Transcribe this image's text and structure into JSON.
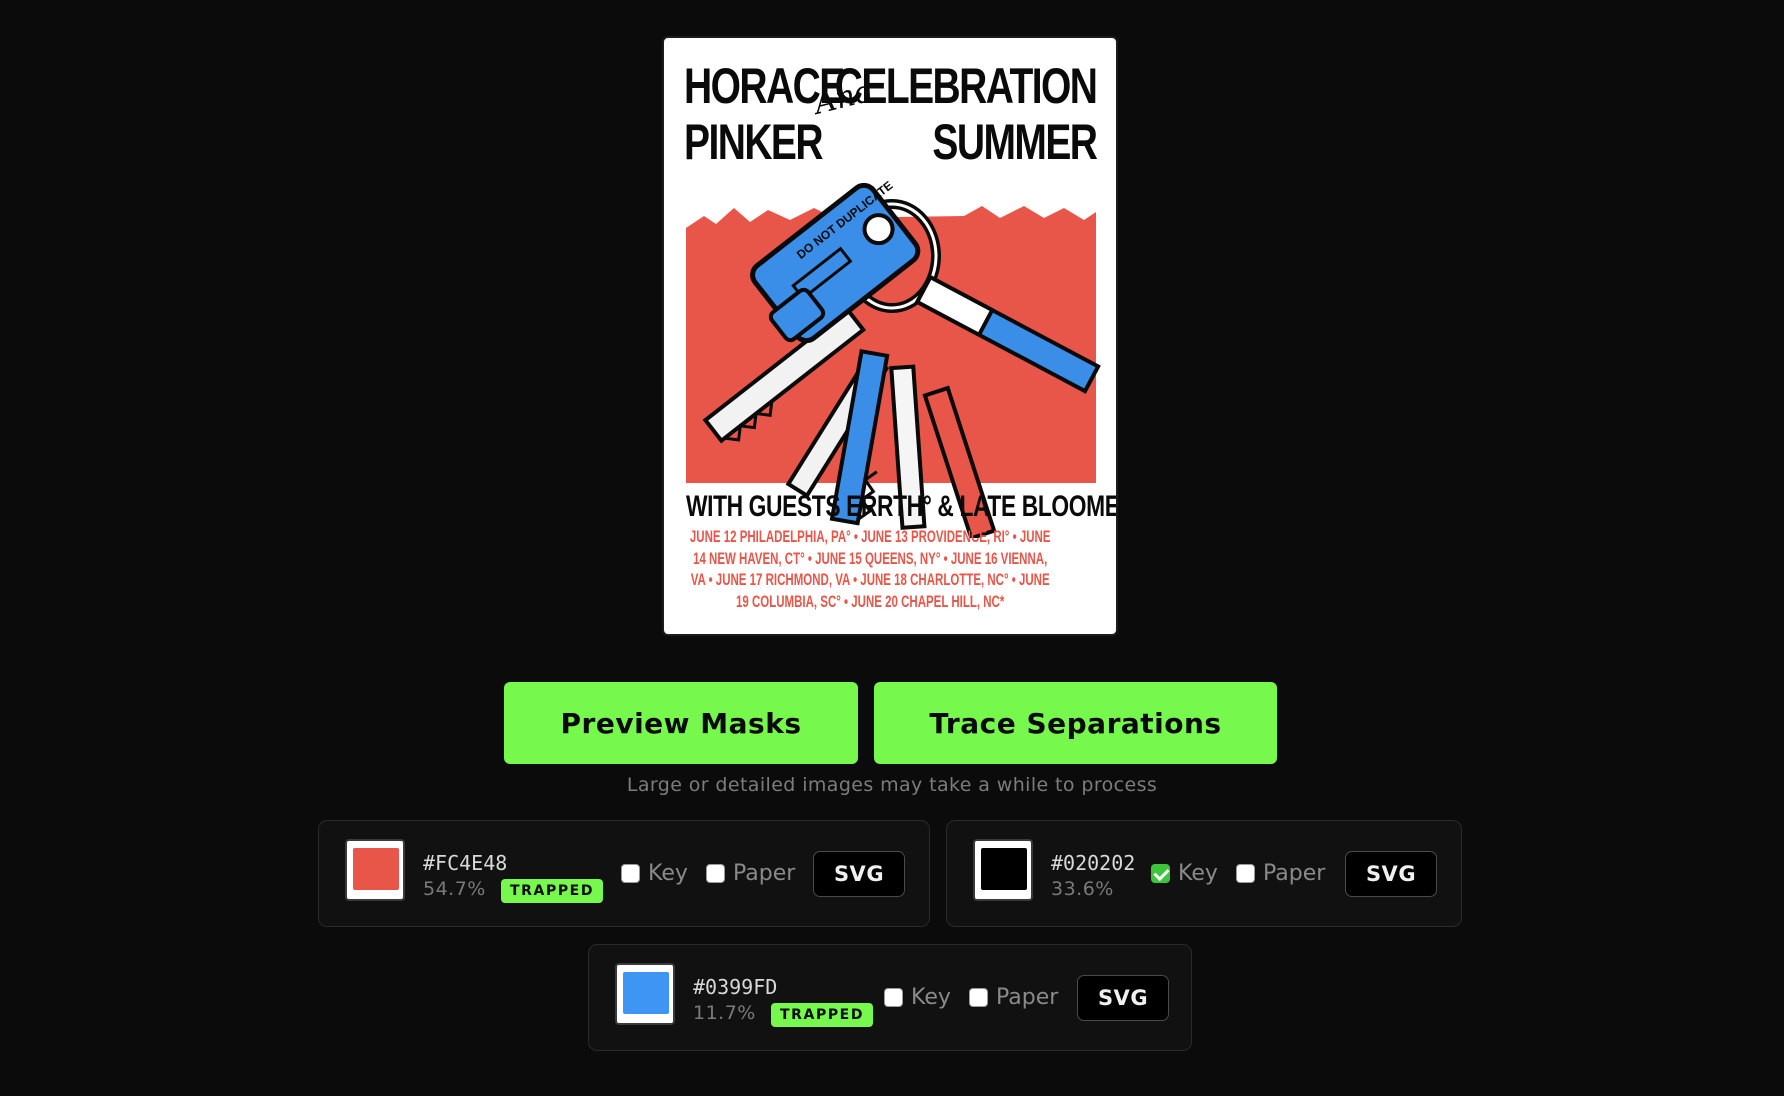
{
  "poster": {
    "title_left_1": "HORACE",
    "title_left_2": "PINKER",
    "title_and": "And",
    "title_right_1": "CELEBRATION",
    "title_right_2": "SUMMER",
    "key_tag_text": "DO NOT DUPLICATE",
    "guests": "WITH GUESTS ERRTH° & LATE BLOOMER*",
    "dates": "JUNE 12 PHILADELPHIA, PA° • JUNE 13 PROVIDENCE, RI° • JUNE 14 NEW HAVEN, CT° • JUNE 15 QUEENS, NY° • JUNE 16 VIENNA, VA • JUNE 17 RICHMOND, VA • JUNE 18 CHARLOTTE, NC° • JUNE 19 COLUMBIA, SC° • JUNE 20 CHAPEL HILL, NC*"
  },
  "actions": {
    "preview_label": "Preview Masks",
    "trace_label": "Trace Separations",
    "hint": "Large or detailed images may take a while to process"
  },
  "separations": [
    {
      "hex": "#FC4E48",
      "swatch_color": "#e8564a",
      "percent": "54.7%",
      "badge": "TRAPPED",
      "key_label": "Key",
      "key_checked": false,
      "paper_label": "Paper",
      "paper_checked": false,
      "svg_label": "SVG"
    },
    {
      "hex": "#020202",
      "swatch_color": "#000000",
      "percent": "33.6%",
      "badge": "",
      "key_label": "Key",
      "key_checked": true,
      "paper_label": "Paper",
      "paper_checked": false,
      "svg_label": "SVG"
    },
    {
      "hex": "#0399FD",
      "swatch_color": "#3f95f3",
      "percent": "11.7%",
      "badge": "TRAPPED",
      "key_label": "Key",
      "key_checked": false,
      "paper_label": "Paper",
      "paper_checked": false,
      "svg_label": "SVG"
    }
  ],
  "colors": {
    "accent": "#77f84c",
    "background": "#0b0b0b",
    "poster_red": "#e8564a",
    "poster_blue": "#3a8ee8"
  }
}
